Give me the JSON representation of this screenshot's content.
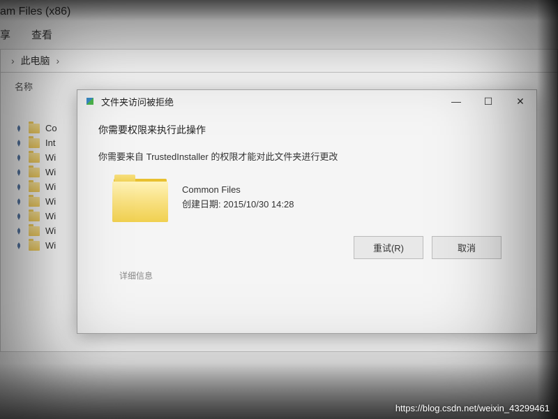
{
  "explorer": {
    "window_title": "am Files (x86)",
    "ribbon": {
      "share_label": "享",
      "view_label": "查看"
    },
    "breadcrumb": {
      "item1": "此电脑",
      "sep": "›"
    },
    "column": {
      "name_header": "名称"
    },
    "files": [
      {
        "label": "Co"
      },
      {
        "label": "Int"
      },
      {
        "label": "Wi"
      },
      {
        "label": "Wi"
      },
      {
        "label": "Wi"
      },
      {
        "label": "Wi"
      },
      {
        "label": "Wi"
      },
      {
        "label": "Wi"
      },
      {
        "label": "Wi"
      }
    ]
  },
  "dialog": {
    "title": "文件夹访问被拒绝",
    "heading": "你需要权限来执行此操作",
    "message": "你需要来自 TrustedInstaller 的权限才能对此文件夹进行更改",
    "folder_name": "Common Files",
    "date_label": "创建日期: ",
    "date_value": "2015/10/30 14:28",
    "retry_label": "重试(R)",
    "cancel_label": "取消",
    "more_info_label": "详细信息",
    "minimize_glyph": "—",
    "maximize_glyph": "☐",
    "close_glyph": "✕"
  },
  "watermark": "https://blog.csdn.net/weixin_43299461"
}
